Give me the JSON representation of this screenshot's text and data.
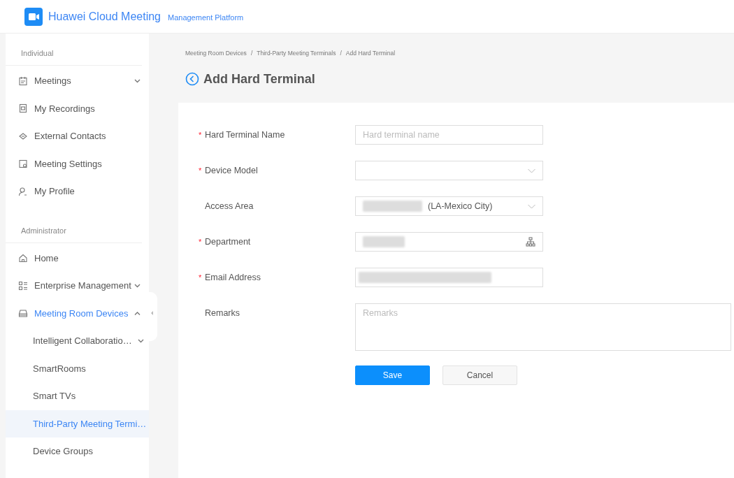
{
  "header": {
    "product": "Huawei Cloud Meeting",
    "subtitle": "Management Platform"
  },
  "sidebar": {
    "sections": [
      {
        "title": "Individual",
        "items": [
          {
            "label": "Meetings",
            "expanded": false,
            "selected": false
          },
          {
            "label": "My Recordings",
            "selected": false
          },
          {
            "label": "External Contacts",
            "selected": false
          },
          {
            "label": "Meeting Settings",
            "selected": false
          },
          {
            "label": "My Profile",
            "selected": false
          }
        ]
      },
      {
        "title": "Administrator",
        "items": [
          {
            "label": "Home",
            "selected": false
          },
          {
            "label": "Enterprise Management",
            "expanded": false,
            "selected": false
          },
          {
            "label": "Meeting Room Devices",
            "expanded": true,
            "selected": true,
            "children": [
              {
                "label": "Intelligent Collaboratio…",
                "expanded": false,
                "selected": false
              },
              {
                "label": "SmartRooms",
                "selected": false
              },
              {
                "label": "Smart TVs",
                "selected": false
              },
              {
                "label": "Third-Party Meeting Termi…",
                "selected": true
              },
              {
                "label": "Device Groups",
                "selected": false
              }
            ]
          }
        ]
      }
    ]
  },
  "breadcrumb": {
    "items": [
      "Meeting Room Devices",
      "Third-Party Meeting Terminals",
      "Add Hard Terminal"
    ],
    "separators": [
      "/",
      "/"
    ]
  },
  "page_title": "Add Hard Terminal",
  "form": {
    "fields": [
      {
        "kind": "text",
        "label": "Hard Terminal Name",
        "required_mark": "*",
        "placeholder": "Hard terminal name"
      },
      {
        "kind": "select",
        "label": "Device Model",
        "required_mark": "*"
      },
      {
        "kind": "select",
        "label": "Access Area",
        "value": "(LA-Mexico City)",
        "redacted": true
      },
      {
        "kind": "tree",
        "label": "Department",
        "required_mark": "*",
        "redacted": true
      },
      {
        "kind": "text",
        "label": "Email Address",
        "required_mark": "*",
        "redacted": true
      },
      {
        "kind": "textarea",
        "label": "Remarks",
        "placeholder": "Remarks"
      }
    ],
    "buttons": [
      {
        "label": "Save",
        "primary": true
      },
      {
        "label": "Cancel",
        "primary": false
      }
    ]
  }
}
